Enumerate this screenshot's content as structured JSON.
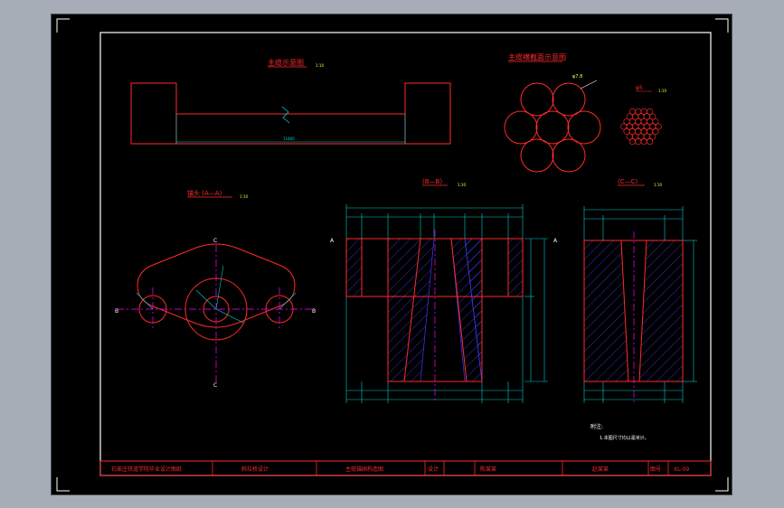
{
  "drawing": {
    "views": {
      "main_cable": "主缆示意图",
      "cross_section": "主缆横截面示意图",
      "anchor_plan": "锚头 (A—A)",
      "section_bb": "(B—B)",
      "section_cc": "(C—C)"
    },
    "scale_suffix": "1:10",
    "dims": {
      "cable_length": "11800",
      "wire_d": "φ5",
      "strand_d": "φ7.8"
    },
    "section_labels": {
      "a": "A",
      "b": "B",
      "c": "C"
    },
    "notes": {
      "title": "附注:",
      "line1": "1.本图尺寸均以毫米计。"
    },
    "title_block": {
      "school": "石家庄铁道学院毕业设计图纸",
      "project": "斜拉桥设计",
      "drawing_name": "主缆锚固构造图",
      "design_label": "设计",
      "designer": "陈某某",
      "check_label": "审核",
      "checker": "赵某某",
      "sheet_label": "图号",
      "sheet_no": "XL-09"
    }
  },
  "colors": {
    "background": "#000000",
    "frame": "#ffffff",
    "outline": "#ff2020",
    "dimension": "#00d0d0",
    "centerline": "#ff00ff",
    "hatch": "#3b3bff",
    "text": "#ffff40",
    "titleblock": "#ff2020"
  }
}
